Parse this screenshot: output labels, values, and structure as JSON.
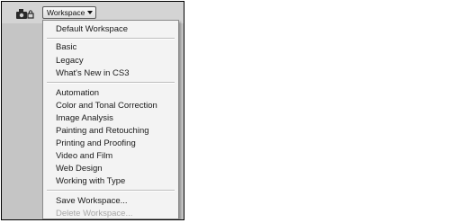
{
  "toolbar": {
    "workspace_button_label": "Workspace",
    "left_icon": "camera-lock-icon"
  },
  "menu": {
    "items": [
      {
        "label": "Default Workspace",
        "enabled": true
      },
      {
        "label": "Basic",
        "enabled": true
      },
      {
        "label": "Legacy",
        "enabled": true
      },
      {
        "label": "What's New in CS3",
        "enabled": true
      },
      {
        "label": "Automation",
        "enabled": true
      },
      {
        "label": "Color and Tonal Correction",
        "enabled": true
      },
      {
        "label": "Image Analysis",
        "enabled": true
      },
      {
        "label": "Painting and Retouching",
        "enabled": true
      },
      {
        "label": "Printing and Proofing",
        "enabled": true
      },
      {
        "label": "Video and Film",
        "enabled": true
      },
      {
        "label": "Web Design",
        "enabled": true
      },
      {
        "label": "Working with Type",
        "enabled": true
      },
      {
        "label": "Save Workspace...",
        "enabled": true
      },
      {
        "label": "Delete Workspace...",
        "enabled": false
      }
    ]
  }
}
